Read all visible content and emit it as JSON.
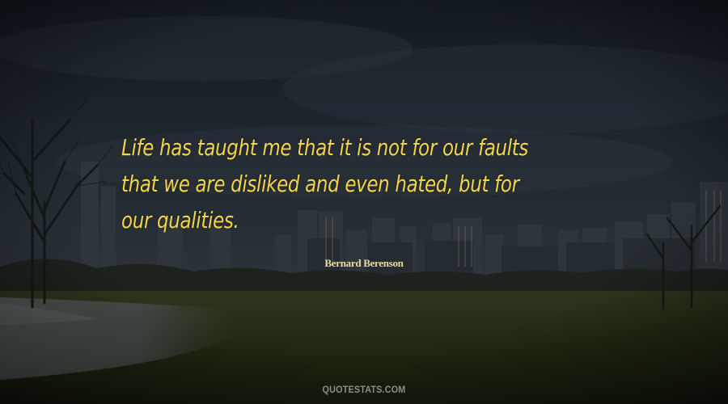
{
  "quote": {
    "lines": [
      "Life has taught me that it is not for our faults",
      "that we are disliked and even hated, but for",
      "our qualities."
    ]
  },
  "author": "Bernard Berenson",
  "watermark": "QUOTESTATS.COM",
  "colors": {
    "quote_text": "#f2d34a",
    "author_text": "#e9dca3",
    "sky_top": "#1c2530",
    "sky_mid": "#2f3b45",
    "lawn": "#2e3a1d",
    "snow": "#6f7577",
    "watermark": "#8d8f86"
  }
}
